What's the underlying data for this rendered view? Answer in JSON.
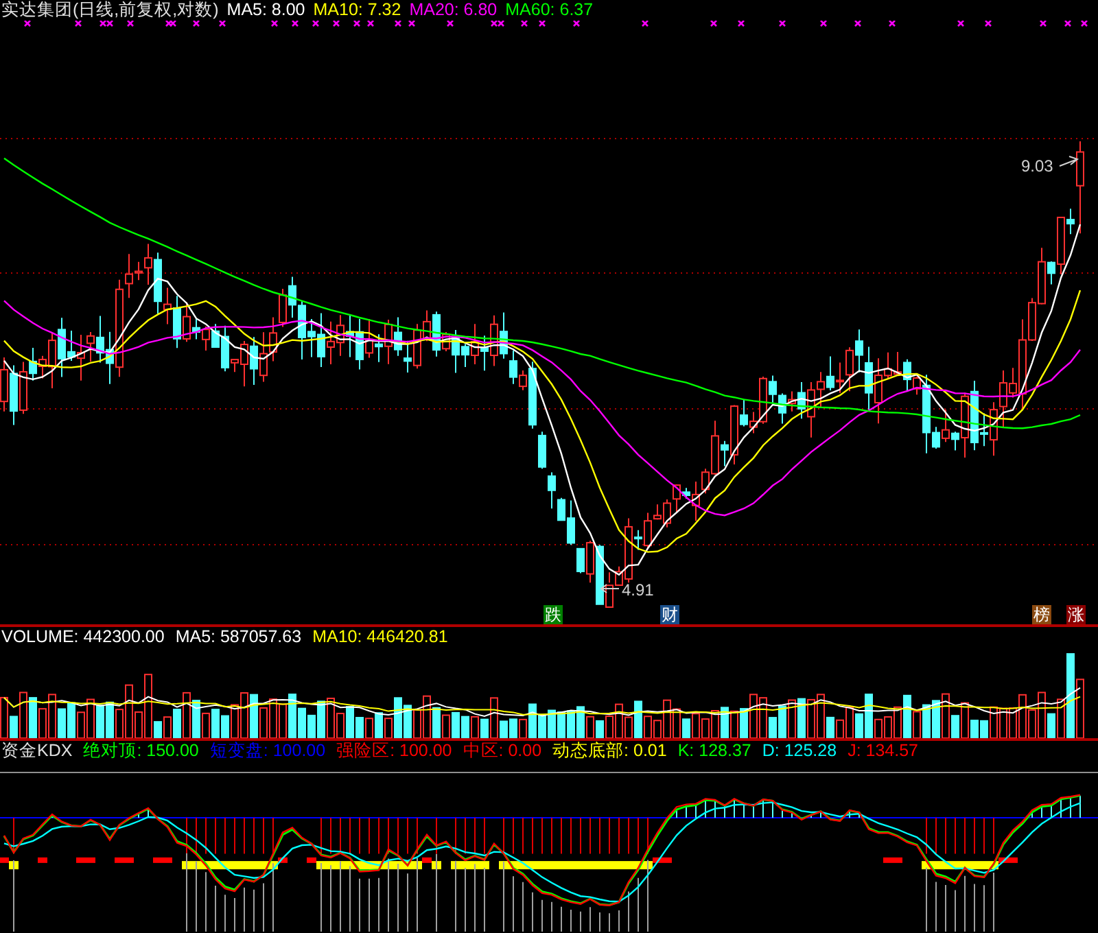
{
  "main_chart": {
    "legend": [
      {
        "label": "实达集团(日线,前复权,对数)",
        "color": "#e0e0e0"
      },
      {
        "label": "MA5: 8.00",
        "color": "#ffffff"
      },
      {
        "label": "MA10: 7.32",
        "color": "#ffff00"
      },
      {
        "label": "MA20: 6.80",
        "color": "#ff00ff"
      },
      {
        "label": "MA60: 6.37",
        "color": "#00ff00"
      }
    ],
    "high_label": "9.03",
    "low_label": "4.91",
    "markers": [
      {
        "label": "跌",
        "color": "#008000"
      },
      {
        "label": "财",
        "color": "#1a4f8a"
      },
      {
        "label": "榜",
        "color": "#8b4a10"
      },
      {
        "label": "涨",
        "color": "#8b0000"
      }
    ]
  },
  "volume_chart": {
    "legend": [
      {
        "label": "VOLUME: 442300.00",
        "color": "#ffffff"
      },
      {
        "label": "MA5: 587057.63",
        "color": "#ffffff"
      },
      {
        "label": "MA10: 446420.81",
        "color": "#ffff00"
      }
    ]
  },
  "kdx_chart": {
    "legend": [
      {
        "label": "资金KDX",
        "color": "#e0e0e0"
      },
      {
        "label": "绝对顶: 150.00",
        "color": "#00ff00"
      },
      {
        "label": "短变盘: 100.00",
        "color": "#0000ff"
      },
      {
        "label": "强险区: 100.00",
        "color": "#ff0000"
      },
      {
        "label": "中区: 0.00",
        "color": "#ff0000"
      },
      {
        "label": "动态底部: 0.01",
        "color": "#ffff00"
      },
      {
        "label": "K: 128.37",
        "color": "#00ff00"
      },
      {
        "label": "D: 125.28",
        "color": "#00ffff"
      },
      {
        "label": "J: 134.57",
        "color": "#ff0000"
      }
    ]
  }
}
